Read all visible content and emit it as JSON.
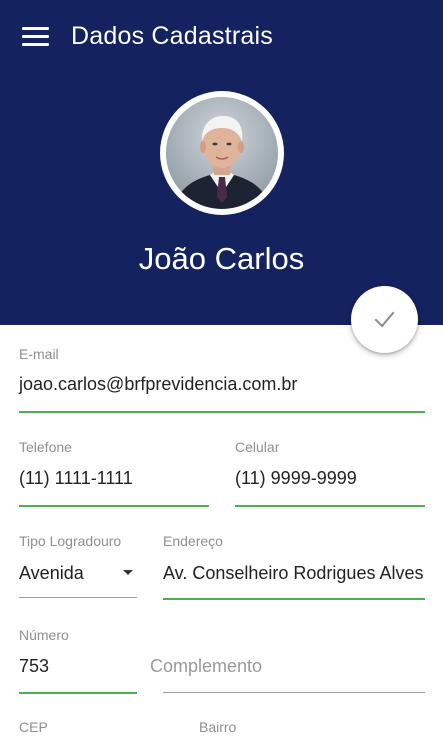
{
  "app_bar": {
    "title": "Dados Cadastrais",
    "menu_icon": "hamburger-menu-icon",
    "background_color": "#152260"
  },
  "profile": {
    "name": "João Carlos"
  },
  "save_button": {
    "icon": "check-icon"
  },
  "accent_color": "#4caf50",
  "form": {
    "email": {
      "label": "E-mail",
      "value": "joao.carlos@brfprevidencia.com.br"
    },
    "telefone": {
      "label": "Telefone",
      "value": "(11) 1111-1111"
    },
    "celular": {
      "label": "Celular",
      "value": "(11) 9999-9999"
    },
    "tipo_logradouro": {
      "label": "Tipo Logradouro",
      "value": "Avenida"
    },
    "endereco": {
      "label": "Endereço",
      "value": "Av. Conselheiro Rodrigues Alves"
    },
    "numero": {
      "label": "Número",
      "value": "753"
    },
    "complemento": {
      "placeholder": "Complemento"
    },
    "cep": {
      "label": "CEP"
    },
    "bairro": {
      "label": "Bairro"
    }
  }
}
